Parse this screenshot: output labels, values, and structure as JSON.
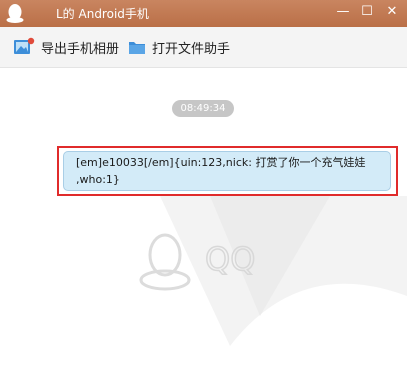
{
  "window": {
    "title": "L的 Android手机",
    "minimize_label": "—",
    "maximize_label": "☐",
    "close_label": "✕"
  },
  "toolbar": {
    "export_album_label": "导出手机相册",
    "open_file_helper_label": "打开文件助手"
  },
  "chat": {
    "timestamp": "08:49:34",
    "message_line1": "[em]e10033[/em]{uin:123,nick: 打赏了你一个充气娃娃",
    "message_line2": ",who:1}"
  },
  "watermark": {
    "text": "QQ"
  },
  "colors": {
    "titlebar": "#ba6f47",
    "bubble_bg": "#d3ebf8",
    "highlight_border": "#e02b2b"
  },
  "icons": [
    "qq-penguin-icon",
    "export-album-icon",
    "folder-icon",
    "minimize-icon",
    "maximize-icon",
    "close-icon"
  ]
}
